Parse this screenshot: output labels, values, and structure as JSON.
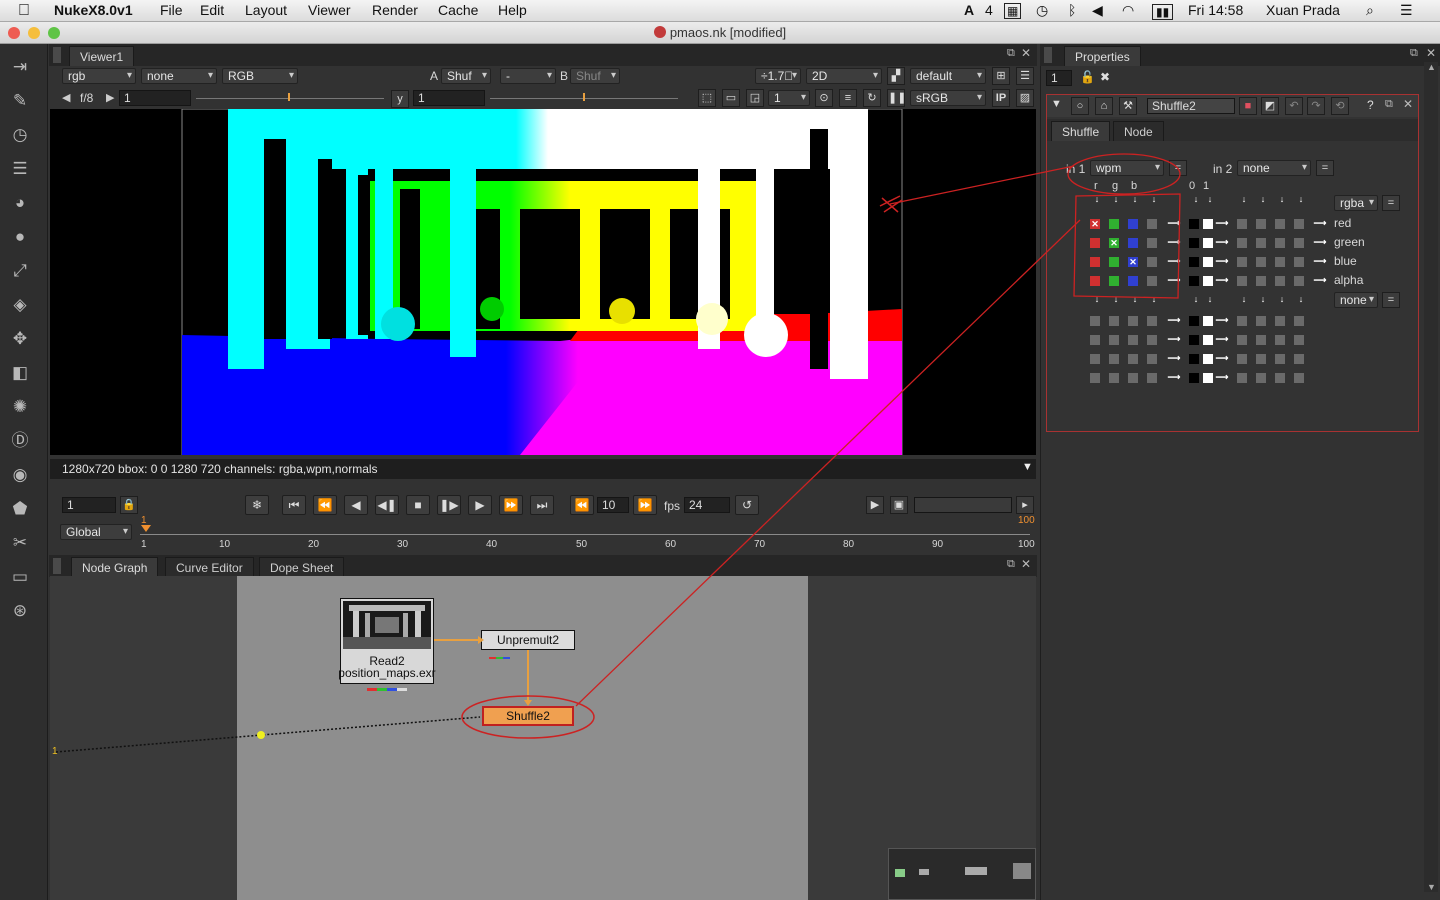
{
  "menubar": {
    "app": "NukeX8.0v1",
    "menus": [
      "File",
      "Edit",
      "Layout",
      "Viewer",
      "Render",
      "Cache",
      "Help"
    ],
    "status_num": "4",
    "clock": "Fri 14:58",
    "user": "Xuan Prada"
  },
  "window": {
    "title": "pmaos.nk [modified]"
  },
  "toolbar": {
    "icons": [
      "node-image-icon",
      "paint-icon",
      "time-icon",
      "channel-icon",
      "color-icon",
      "filter-icon",
      "keyer-icon",
      "merge-icon",
      "transform-icon",
      "3d-icon",
      "particles-icon",
      "deep-icon",
      "views-icon",
      "metadata-icon",
      "tools-icon",
      "toolsets-icon",
      "other-icon"
    ]
  },
  "viewer": {
    "tab": "Viewer1",
    "channel_set": "rgb",
    "matte": "none",
    "display": "RGB",
    "a_label": "A",
    "a_input": "Shuf",
    "compare": "-",
    "b_label": "B",
    "b_input": "Shuf",
    "zoom": "÷1.7ﾞ",
    "view_mode": "2D",
    "lut_default": "default",
    "fstop": "f/8",
    "gain": "1",
    "gamma_label": "y",
    "gamma": "1",
    "downrez": "1",
    "colorspace": "sRGB",
    "ip_label": "IP",
    "info_bar": "1280x720 bbox: 0 0 1280 720 channels: rgba,wpm,normals"
  },
  "playback": {
    "frame": "1",
    "step": "10",
    "fps_label": "fps",
    "fps": "24",
    "range_mode": "Global",
    "ticks": [
      "1",
      "10",
      "20",
      "30",
      "40",
      "50",
      "60",
      "70",
      "80",
      "90",
      "100"
    ],
    "cur_frame_mark": "1",
    "end_mark": "100"
  },
  "nodegraph": {
    "tabs": [
      "Node Graph",
      "Curve Editor",
      "Dope Sheet"
    ],
    "read_label": "Read2",
    "read_file": "position_maps.exr",
    "unpremult": "Unpremult2",
    "shuffle": "Shuffle2",
    "pipe_label": "1"
  },
  "properties": {
    "title": "Properties",
    "max_panels": "1",
    "node_name": "Shuffle2",
    "tabs": [
      "Shuffle",
      "Node"
    ],
    "in1_label": "in 1",
    "in1_value": "wpm",
    "in2_label": "in 2",
    "in2_value": "none",
    "eq": "=",
    "col_headers": [
      "r",
      "g",
      "b",
      "0",
      "1"
    ],
    "out1": "rgba",
    "out2": "none",
    "out_channels": [
      "red",
      "green",
      "blue",
      "alpha"
    ],
    "help": "?"
  },
  "colors": {
    "accent_orange": "#e8a040",
    "annotation_red": "#cc2222",
    "shuffle_node": "#f0a050"
  }
}
